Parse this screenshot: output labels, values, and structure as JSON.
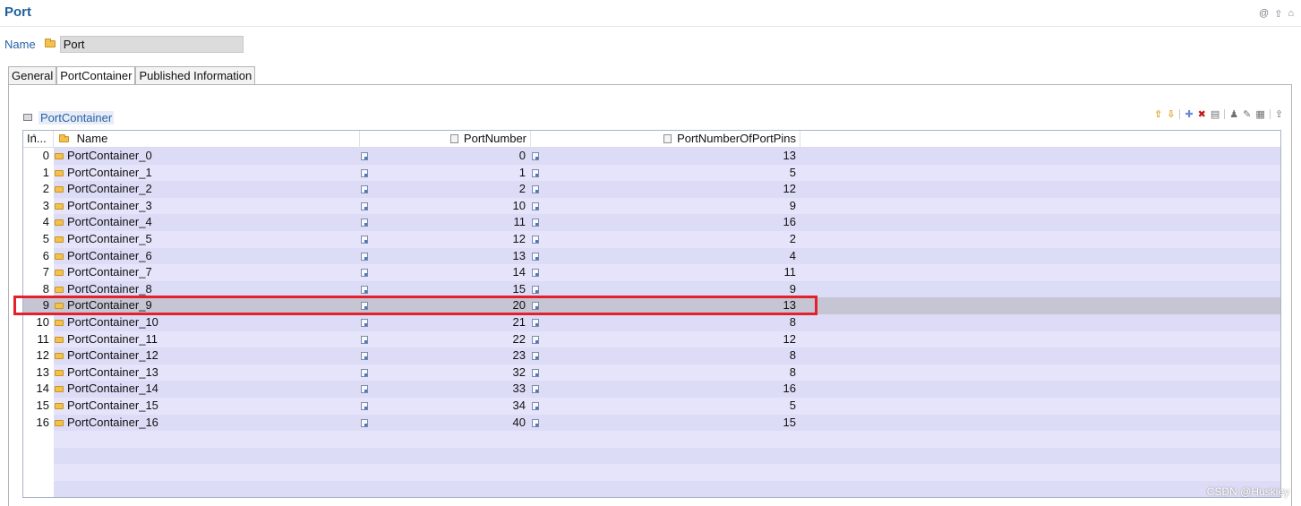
{
  "header": {
    "title": "Port",
    "icons": [
      "link-icon",
      "up-icon",
      "home-icon"
    ]
  },
  "name_field": {
    "label": "Name",
    "value": "Port"
  },
  "tabs": [
    {
      "label": "General",
      "active": false
    },
    {
      "label": "PortContainer",
      "active": true
    },
    {
      "label": "Published Information",
      "active": false
    }
  ],
  "section": {
    "title": "PortContainer"
  },
  "toolbar": {
    "icons": [
      "move-up-icon",
      "move-down-icon",
      "add-icon",
      "delete-icon",
      "copy-icon",
      "user-icon",
      "edit-icon",
      "table-icon",
      "export-icon"
    ]
  },
  "table": {
    "columns": [
      "In...",
      "Name",
      "PortNumber",
      "PortNumberOfPortPins"
    ],
    "rows": [
      {
        "index": "0",
        "name": "PortContainer_0",
        "port": "0",
        "pins": "13"
      },
      {
        "index": "1",
        "name": "PortContainer_1",
        "port": "1",
        "pins": "5"
      },
      {
        "index": "2",
        "name": "PortContainer_2",
        "port": "2",
        "pins": "12"
      },
      {
        "index": "3",
        "name": "PortContainer_3",
        "port": "10",
        "pins": "9"
      },
      {
        "index": "4",
        "name": "PortContainer_4",
        "port": "11",
        "pins": "16"
      },
      {
        "index": "5",
        "name": "PortContainer_5",
        "port": "12",
        "pins": "2"
      },
      {
        "index": "6",
        "name": "PortContainer_6",
        "port": "13",
        "pins": "4"
      },
      {
        "index": "7",
        "name": "PortContainer_7",
        "port": "14",
        "pins": "11"
      },
      {
        "index": "8",
        "name": "PortContainer_8",
        "port": "15",
        "pins": "9"
      },
      {
        "index": "9",
        "name": "PortContainer_9",
        "port": "20",
        "pins": "13"
      },
      {
        "index": "10",
        "name": "PortContainer_10",
        "port": "21",
        "pins": "8"
      },
      {
        "index": "11",
        "name": "PortContainer_11",
        "port": "22",
        "pins": "12"
      },
      {
        "index": "12",
        "name": "PortContainer_12",
        "port": "23",
        "pins": "8"
      },
      {
        "index": "13",
        "name": "PortContainer_13",
        "port": "32",
        "pins": "8"
      },
      {
        "index": "14",
        "name": "PortContainer_14",
        "port": "33",
        "pins": "16"
      },
      {
        "index": "15",
        "name": "PortContainer_15",
        "port": "34",
        "pins": "5"
      },
      {
        "index": "16",
        "name": "PortContainer_16",
        "port": "40",
        "pins": "15"
      }
    ],
    "selected_row": 9
  },
  "watermark": "CSDN @Huskiey",
  "colors": {
    "title": "#1f5f9a",
    "row_fill": "#dcdcf7",
    "selected_fill": "#c5c5d3",
    "highlight": "#e5202c"
  }
}
